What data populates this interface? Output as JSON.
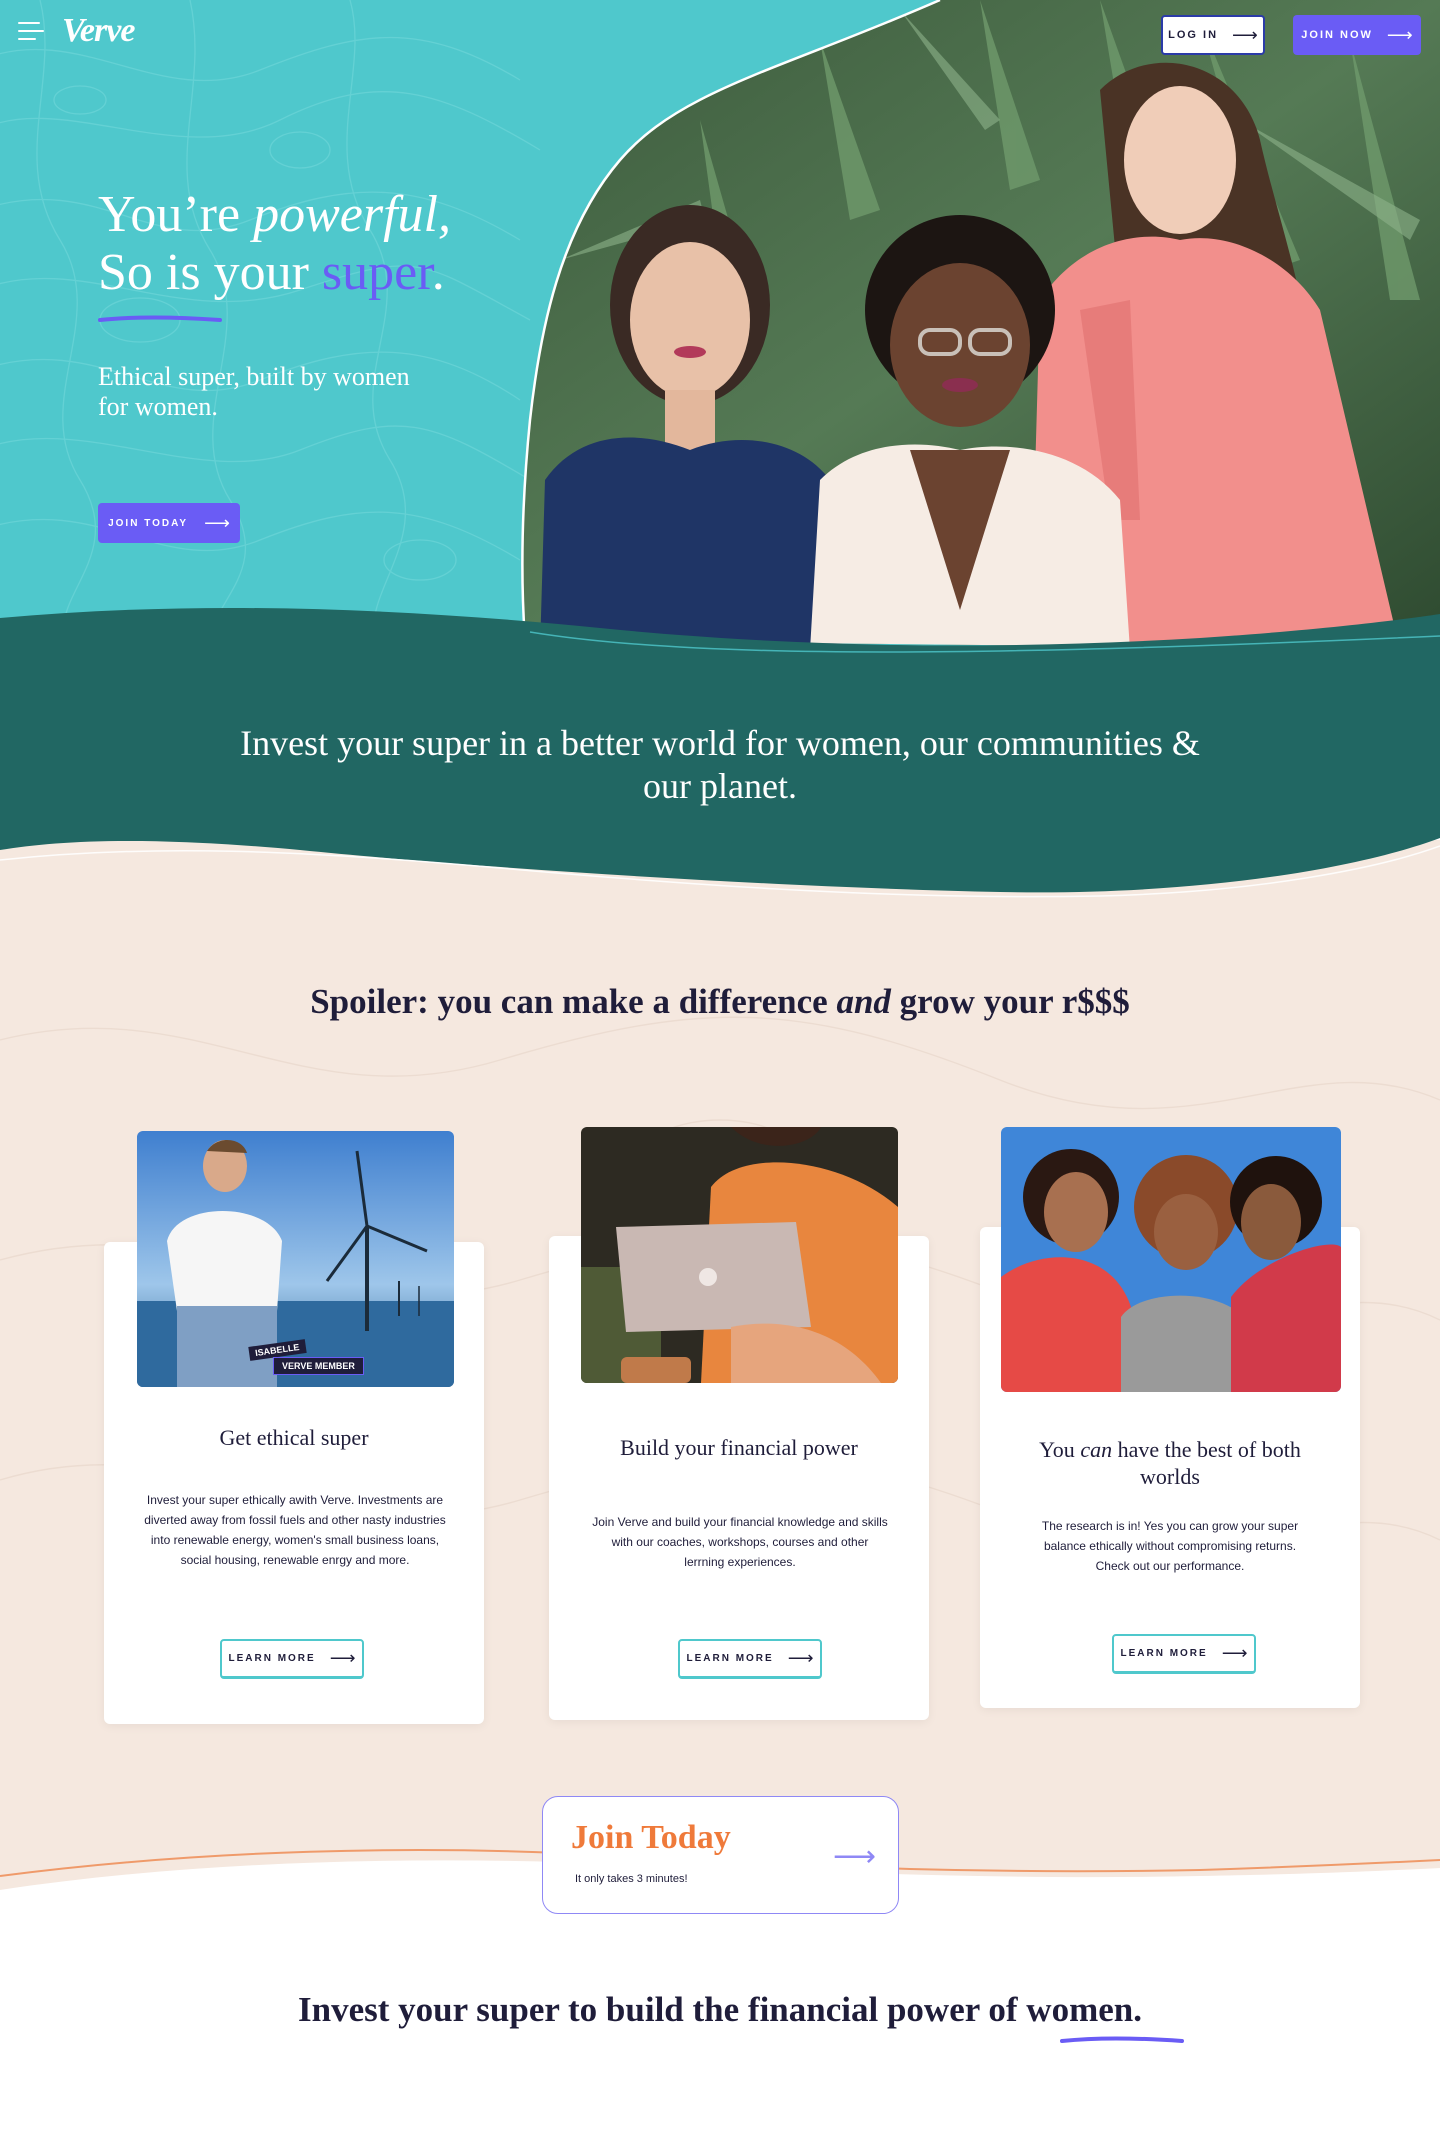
{
  "brand": {
    "logo_text": "Verve"
  },
  "nav": {
    "menu_icon": "hamburger-icon",
    "login_label": "LOG IN",
    "join_label": "JOIN NOW"
  },
  "hero": {
    "line1_prefix": "You’re ",
    "line1_italic": "powerful,",
    "line2_prefix": "So is your ",
    "line2_accent": "super",
    "line2_suffix": ".",
    "subtitle": "Ethical super, built by women for women.",
    "cta_label": "JOIN TODAY"
  },
  "band": {
    "text": "Invest your super in a better world for women, our communities & our planet."
  },
  "section": {
    "heading_prefix": "Spoiler: you can make a difference ",
    "heading_italic": "and",
    "heading_suffix": " grow your r$$$"
  },
  "cards": [
    {
      "title": "Get ethical super",
      "body": "Invest your super ethically awith Verve. Investments are diverted away from fossil fuels and other nasty industries into renewable energy, women's small business loans, social housing, renewable enrgy and more.",
      "badge_name": "ISABELLE",
      "badge_role": "VERVE MEMBER",
      "button": "LEARN MORE"
    },
    {
      "title": "Build your financial power",
      "body": "Join Verve and build your financial knowledge and skills with our coaches, workshops, courses and other lerrning experiences.",
      "button": "LEARN MORE"
    },
    {
      "title_prefix": "You ",
      "title_italic": "can",
      "title_suffix": " have the best of both worlds",
      "body": "The research is in! Yes you can grow your super balance ethically without compromising returns. Check out our performance.",
      "button": "LEARN MORE"
    }
  ],
  "join": {
    "title": "Join Today",
    "subtitle": "It only takes 3 minutes!"
  },
  "bottom": {
    "heading": "Invest your super to build the financial power of women."
  },
  "colors": {
    "hero_teal": "#4fc8cc",
    "dark_teal": "#216763",
    "purple": "#6a5cf5",
    "beige": "#f5e8df",
    "orange": "#ef7a3a",
    "navy": "#1f1d3a"
  }
}
